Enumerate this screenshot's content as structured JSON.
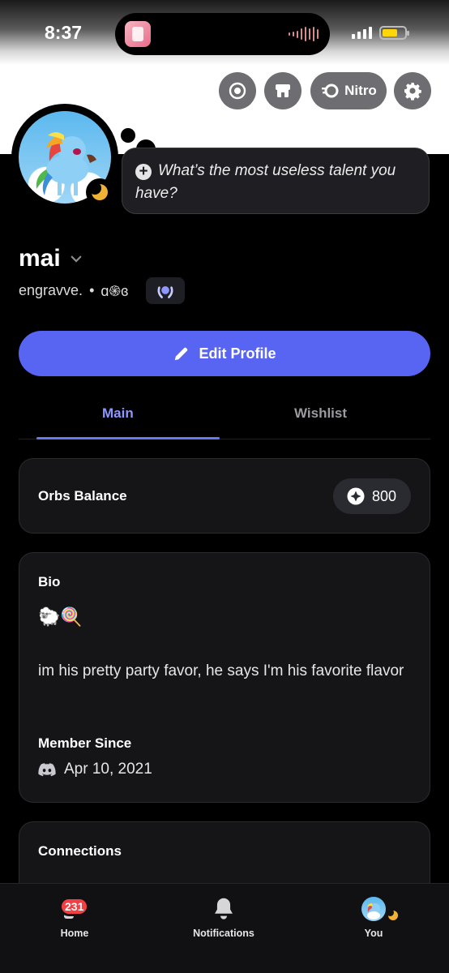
{
  "status_bar": {
    "time": "8:37"
  },
  "top_actions": {
    "nitro_label": "Nitro"
  },
  "profile": {
    "custom_status_prompt": "What’s the most useless talent you have?",
    "display_name": "mai",
    "username": "engravve.",
    "separator": "•",
    "pronouns": "ɑ֍ɞ"
  },
  "edit_profile_label": "Edit Profile",
  "tabs": [
    {
      "label": "Main",
      "active": true
    },
    {
      "label": "Wishlist",
      "active": false
    }
  ],
  "orbs": {
    "label": "Orbs Balance",
    "value": "800"
  },
  "bio": {
    "title": "Bio",
    "emojis": "🐑🍭",
    "text": "im his pretty party favor, he says I'm his favorite flavor"
  },
  "member_since": {
    "title": "Member Since",
    "date": "Apr 10, 2021"
  },
  "connections": {
    "title": "Connections"
  },
  "bottom_nav": {
    "home_label": "Home",
    "home_badge": "231",
    "notifications_label": "Notifications",
    "you_label": "You"
  },
  "colors": {
    "accent": "#5865f2",
    "tab_active": "#8e97ff",
    "badge_red": "#f23f43",
    "idle_moon": "#f0b232"
  }
}
